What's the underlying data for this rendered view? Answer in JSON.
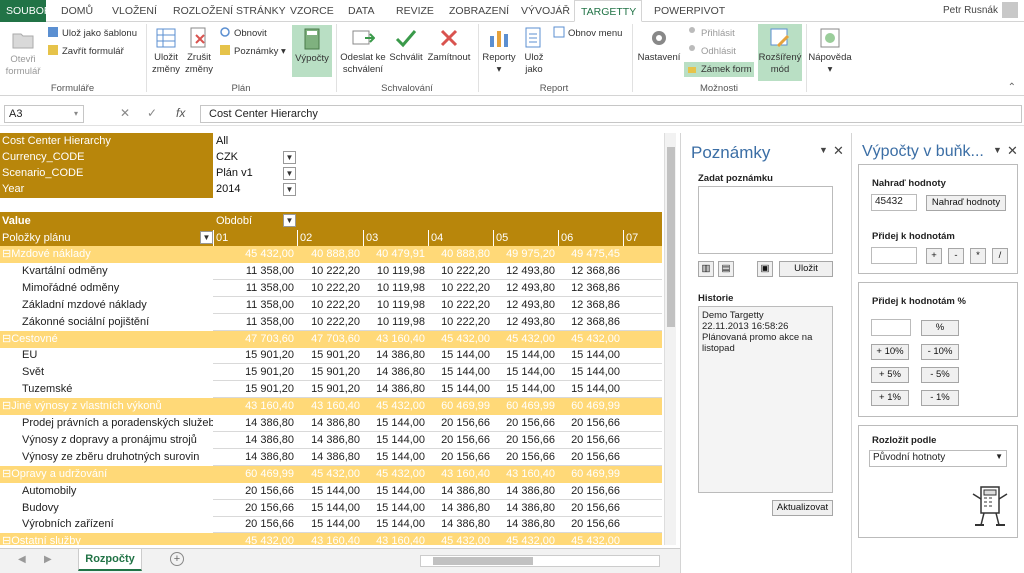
{
  "tabs": [
    "SOUBOR",
    "DOMŮ",
    "VLOŽENÍ",
    "ROZLOŽENÍ STRÁNKY",
    "VZORCE",
    "DATA",
    "REVIZE",
    "ZOBRAZENÍ",
    "VÝVOJÁŘ",
    "TARGETTY",
    "POWERPIVOT"
  ],
  "user": "Petr Rusnák",
  "ribbon": {
    "otevri": "Otevři formulář",
    "uloz_sablon": "Ulož jako šablonu",
    "zavrit_form": "Zavřít formulář",
    "ulozit_zmeny": "Uložit změny",
    "zrusit_zmeny": "Zrušit změny",
    "obnovit": "Obnovit",
    "poznamky": "Poznámky",
    "vypocty": "Výpočty",
    "odeslat": "Odeslat ke schválení",
    "schvalit": "Schválit",
    "zamitnout": "Zamítnout",
    "reporty": "Reporty",
    "uloz_jako": "Ulož jako",
    "obnov_menu": "Obnov menu",
    "nastaveni": "Nastavení",
    "prihlasit": "Přihlásit",
    "odhlasit": "Odhlásit",
    "zamek": "Zámek form",
    "rozsireny": "Rozšířený mód",
    "napoveda": "Nápověda",
    "groups": {
      "formulare": "Formuláře",
      "plan": "Plán",
      "schvalovani": "Schvalování",
      "report": "Report",
      "moznosti": "Možnosti"
    }
  },
  "formula": {
    "cell": "A3",
    "value": "Cost Center Hierarchy"
  },
  "filters": [
    {
      "label": "Cost Center Hierarchy",
      "value": "All"
    },
    {
      "label": "Currency_CODE",
      "value": "CZK"
    },
    {
      "label": "Scenario_CODE",
      "value": "Plán v1"
    },
    {
      "label": "Year",
      "value": "2014"
    }
  ],
  "pivot": {
    "value_label": "Value",
    "period_label": "Období",
    "rows_label": "Položky plánu",
    "cols": [
      "01",
      "02",
      "03",
      "04",
      "05",
      "06",
      "07"
    ],
    "rows": [
      {
        "type": "g",
        "label": "Mzdové náklady",
        "vals": [
          "45 432,00",
          "40 888,80",
          "40 479,91",
          "40 888,80",
          "49 975,20",
          "49 475,45",
          "49 9"
        ]
      },
      {
        "type": "r",
        "label": "Kvartální odměny",
        "vals": [
          "11 358,00",
          "10 222,20",
          "10 119,98",
          "10 222,20",
          "12 493,80",
          "12 368,86",
          "12 4"
        ]
      },
      {
        "type": "r",
        "label": "Mimořádné odměny",
        "vals": [
          "11 358,00",
          "10 222,20",
          "10 119,98",
          "10 222,20",
          "12 493,80",
          "12 368,86",
          "12 4"
        ]
      },
      {
        "type": "r",
        "label": "Základní mzdové náklady",
        "vals": [
          "11 358,00",
          "10 222,20",
          "10 119,98",
          "10 222,20",
          "12 493,80",
          "12 368,86",
          "12 4"
        ]
      },
      {
        "type": "r",
        "label": "Zákonné sociální pojištění",
        "vals": [
          "11 358,00",
          "10 222,20",
          "10 119,98",
          "10 222,20",
          "12 493,80",
          "12 368,86",
          "12 4"
        ]
      },
      {
        "type": "g",
        "label": "Cestovné",
        "vals": [
          "47 703,60",
          "47 703,60",
          "43 160,40",
          "45 432,00",
          "45 432,00",
          "45 432,00",
          "45 4"
        ]
      },
      {
        "type": "r",
        "label": "EU",
        "vals": [
          "15 901,20",
          "15 901,20",
          "14 386,80",
          "15 144,00",
          "15 144,00",
          "15 144,00",
          "15 1"
        ]
      },
      {
        "type": "r",
        "label": "Svět",
        "vals": [
          "15 901,20",
          "15 901,20",
          "14 386,80",
          "15 144,00",
          "15 144,00",
          "15 144,00",
          "15 1"
        ]
      },
      {
        "type": "r",
        "label": "Tuzemské",
        "vals": [
          "15 901,20",
          "15 901,20",
          "14 386,80",
          "15 144,00",
          "15 144,00",
          "15 144,00",
          "15 1"
        ]
      },
      {
        "type": "g",
        "label": "Jiné výnosy z vlastních výkonů",
        "vals": [
          "43 160,40",
          "43 160,40",
          "45 432,00",
          "60 469,99",
          "60 469,99",
          "60 469,99",
          "60 4"
        ]
      },
      {
        "type": "r",
        "label": "Prodej právních a poradenských služeb",
        "vals": [
          "14 386,80",
          "14 386,80",
          "15 144,00",
          "20 156,66",
          "20 156,66",
          "20 156,66",
          "20 1"
        ]
      },
      {
        "type": "r",
        "label": "Výnosy z dopravy a pronájmu strojů",
        "vals": [
          "14 386,80",
          "14 386,80",
          "15 144,00",
          "20 156,66",
          "20 156,66",
          "20 156,66",
          "20 1"
        ]
      },
      {
        "type": "r",
        "label": "Výnosy ze zběru druhotných surovin",
        "vals": [
          "14 386,80",
          "14 386,80",
          "15 144,00",
          "20 156,66",
          "20 156,66",
          "20 156,66",
          "20 1"
        ]
      },
      {
        "type": "g",
        "label": "Opravy a udržování",
        "vals": [
          "60 469,99",
          "45 432,00",
          "45 432,00",
          "43 160,40",
          "43 160,40",
          "60 469,99",
          "60 4"
        ]
      },
      {
        "type": "r",
        "label": "Automobily",
        "vals": [
          "20 156,66",
          "15 144,00",
          "15 144,00",
          "14 386,80",
          "14 386,80",
          "20 156,66",
          "20 1"
        ]
      },
      {
        "type": "r",
        "label": "Budovy",
        "vals": [
          "20 156,66",
          "15 144,00",
          "15 144,00",
          "14 386,80",
          "14 386,80",
          "20 156,66",
          "20 1"
        ]
      },
      {
        "type": "r",
        "label": "Výrobních zařízení",
        "vals": [
          "20 156,66",
          "15 144,00",
          "15 144,00",
          "14 386,80",
          "14 386,80",
          "20 156,66",
          "20 1"
        ]
      },
      {
        "type": "g",
        "label": "Ostatní služby",
        "vals": [
          "45 432,00",
          "43 160,40",
          "43 160,40",
          "45 432,00",
          "45 432,00",
          "45 432,00",
          "45 4"
        ]
      }
    ]
  },
  "sheet_tab": "Rozpočty",
  "notes": {
    "title": "Poznámky",
    "enter_label": "Zadat poznámku",
    "save": "Uložit",
    "history_label": "Historie",
    "history": [
      "Demo Targetty",
      "22.11.2013 16:58:26",
      "Plánovaná promo akce na listopad"
    ],
    "refresh": "Aktualizovat"
  },
  "calc": {
    "title": "Výpočty v buňk...",
    "replace_label": "Nahraď hodnoty",
    "replace_value": "45432",
    "replace_btn": "Nahraď hodnoty",
    "add_label": "Přidej k hodnotám",
    "ops": [
      "+",
      "-",
      "*",
      "/"
    ],
    "pct_label": "Přidej k hodnotám %",
    "pct_btn": "%",
    "pct_plus": [
      "+ 10%",
      "+ 5%",
      "+ 1%"
    ],
    "pct_minus": [
      "- 10%",
      "- 5%",
      "- 1%"
    ],
    "split_label": "Rozložit podle",
    "split_value": "Původní hotnoty"
  }
}
